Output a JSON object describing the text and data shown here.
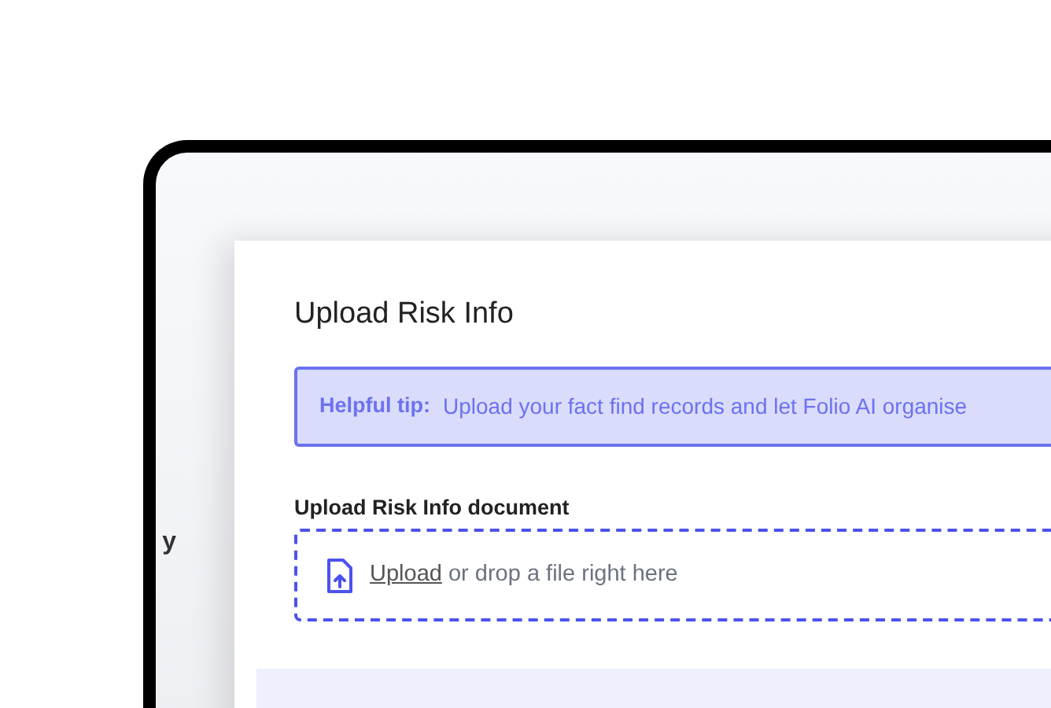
{
  "background_text": "y",
  "modal": {
    "title": "Upload Risk Info",
    "tip": {
      "label": "Helpful tip:",
      "text": "Upload your fact find records and let Folio AI organise"
    },
    "upload": {
      "label": "Upload Risk Info document",
      "link": "Upload",
      "text": "or drop a file right here"
    }
  }
}
